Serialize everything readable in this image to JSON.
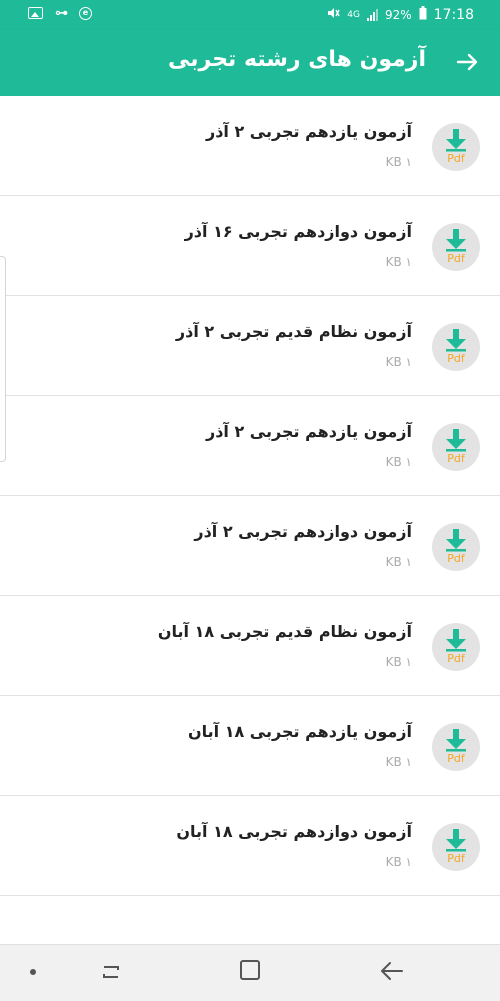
{
  "status_bar": {
    "signal_label": "4G",
    "battery": "92%",
    "time": "17:18"
  },
  "header": {
    "title": "آزمون های رشته تجربی",
    "back_icon": "arrow-right-icon"
  },
  "colors": {
    "primary": "#1fba97",
    "icon_bg": "#e3e3e3",
    "pdf_orange": "#f5a623",
    "text_dark": "#222222",
    "text_muted": "#aaaaaa"
  },
  "items": [
    {
      "title": "آزمون یازدهم تجربی ۲ آذر",
      "size": "۱ KB",
      "icon_label": "Pdf"
    },
    {
      "title": "آزمون دوازدهم تجربی ۱۶ آذر",
      "size": "۱ KB",
      "icon_label": "Pdf"
    },
    {
      "title": "آزمون نظام قدیم تجربی ۲ آذر",
      "size": "۱ KB",
      "icon_label": "Pdf"
    },
    {
      "title": "آزمون یازدهم تجربی ۲ آذر",
      "size": "۱ KB",
      "icon_label": "Pdf"
    },
    {
      "title": "آزمون دوازدهم تجربی ۲ آذر",
      "size": "۱ KB",
      "icon_label": "Pdf"
    },
    {
      "title": "آزمون نظام قدیم تجربی ۱۸ آبان",
      "size": "۱ KB",
      "icon_label": "Pdf"
    },
    {
      "title": "آزمون یازدهم تجربی ۱۸ آبان",
      "size": "۱ KB",
      "icon_label": "Pdf"
    },
    {
      "title": "آزمون دوازدهم تجربی ۱۸ آبان",
      "size": "۱ KB",
      "icon_label": "Pdf"
    }
  ]
}
